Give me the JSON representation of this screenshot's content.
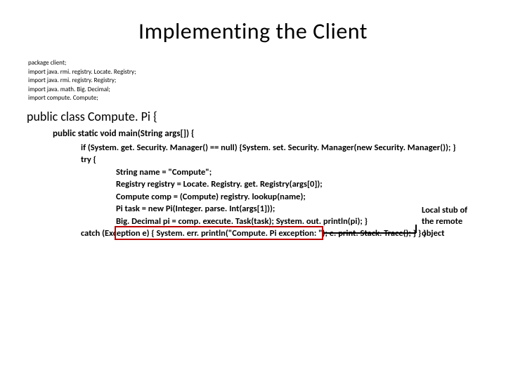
{
  "title": "Implementing the Client",
  "imports": {
    "l1": "package client;",
    "l2": "import java. rmi. registry. Locate. Registry;",
    "l3": "import java. rmi. registry. Registry;",
    "l4": "import java. math. Big. Decimal;",
    "l5": "import compute. Compute;"
  },
  "classDecl": "public class Compute. Pi {",
  "methodDecl": "public static void main(String args[]) {",
  "body": {
    "l1": "if (System. get. Security. Manager() == null) {System. set. Security. Manager(new Security. Manager()); }",
    "l2": "try {",
    "inner": {
      "l1": "String name = \"Compute\";",
      "l2": "Registry registry = Locate. Registry. get. Registry(args[0]);",
      "l3": "Compute comp = (Compute) registry. lookup(name);",
      "l4": "Pi task = new Pi(Integer. parse. Int(args[1]));",
      "l5": "Big. Decimal pi = comp. execute. Task(task); System. out. println(pi); }"
    }
  },
  "catchLine": "catch (Exception e) { System. err. println(\"Compute. Pi exception: \"); e. print. Stack. Trace(); } } }",
  "annotation": {
    "l1": "Local stub of",
    "l2": "the remote",
    "l3": "object"
  }
}
